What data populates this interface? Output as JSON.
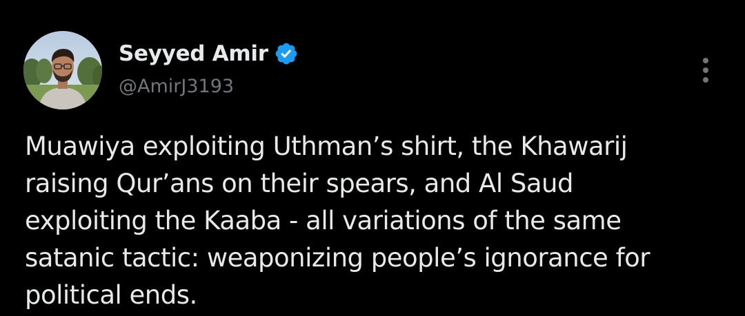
{
  "user": {
    "display_name": "Seyyed Amir",
    "handle": "@AmirJ3193",
    "verified": true,
    "verified_icon": "verified-badge-icon",
    "avatar_icon": "profile-photo"
  },
  "more_icon": "more-vertical-icon",
  "tweet": {
    "text": "Muawiya exploiting Uthman’s shirt, the Khawarij\nraising Qur’ans on their spears, and Al Saud\nexploiting the Kaaba - all variations of the same\nsatanic tactic: weaponizing people’s ignorance for\npolitical ends."
  },
  "colors": {
    "background": "#000000",
    "primary_text": "#e7e9ea",
    "secondary_text": "#71767b",
    "verified_blue": "#1d9bf0"
  }
}
